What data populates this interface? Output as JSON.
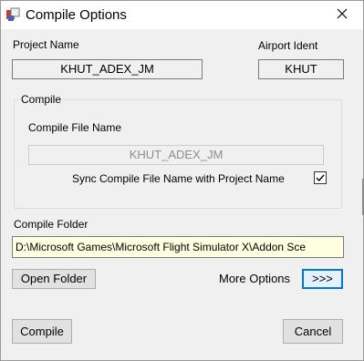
{
  "window": {
    "title": "Compile Options",
    "icons": {
      "app": "compile-app-icon",
      "close": "close-icon"
    }
  },
  "project": {
    "name_label": "Project Name",
    "name_value": "KHUT_ADEX_JM",
    "airport_label": "Airport Ident",
    "airport_value": "KHUT"
  },
  "compile_group": {
    "legend": "Compile",
    "file_name_label": "Compile File Name",
    "file_name_value": "KHUT_ADEX_JM",
    "sync_label": "Sync Compile File Name with Project Name",
    "sync_checked": true
  },
  "folder": {
    "label": "Compile Folder",
    "value": "D:\\Microsoft Games\\Microsoft Flight Simulator X\\Addon Sce"
  },
  "buttons": {
    "open_folder": "Open Folder",
    "more_options_label": "More Options",
    "more_options": ">>>",
    "compile": "Compile",
    "cancel": "Cancel"
  },
  "colors": {
    "window_bg": "#f0f0f0",
    "titlebar_bg": "#ffffff",
    "folder_input_bg": "#ffffe1",
    "focus_border": "#0078d7",
    "disabled_text": "#8d8d8d"
  }
}
